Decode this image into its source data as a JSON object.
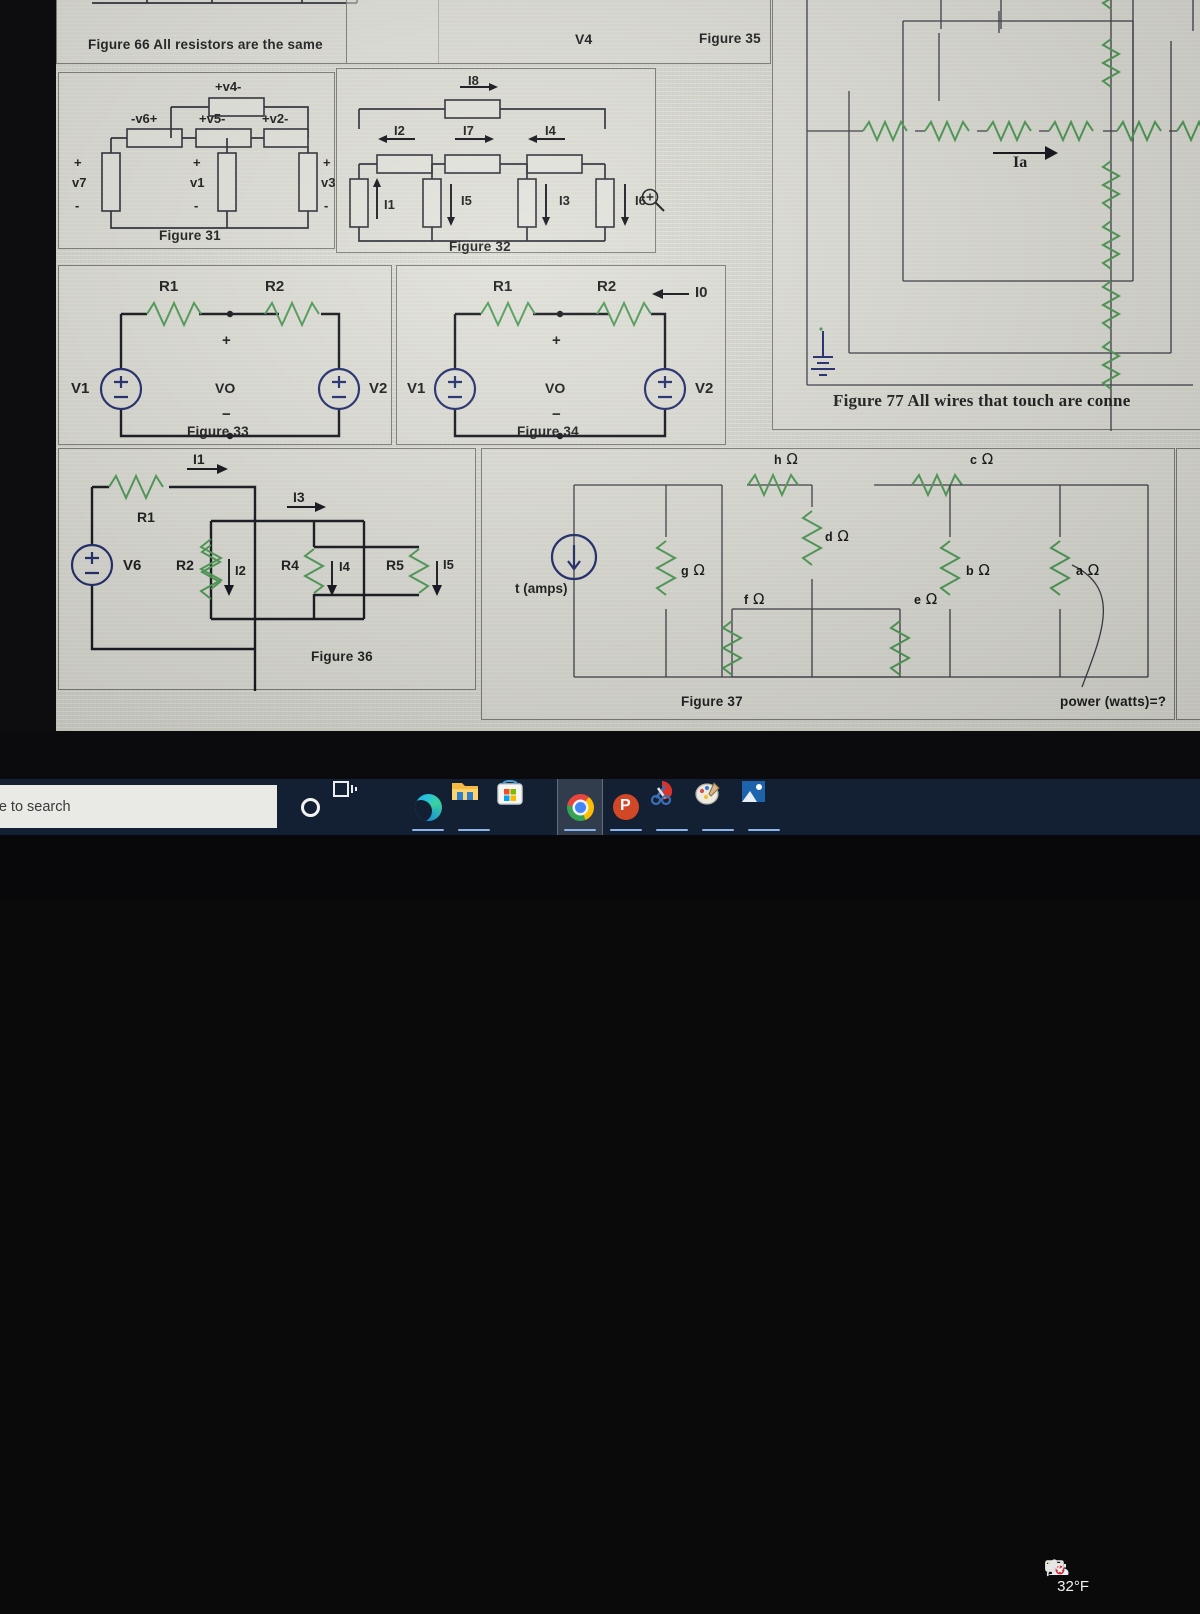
{
  "desktop": {
    "taskbar": {
      "search_placeholder": "re to search",
      "items": [
        {
          "name": "cortana-icon",
          "label": "Cortana"
        },
        {
          "name": "task-view-icon",
          "label": "Task View"
        },
        {
          "name": "edge-icon",
          "label": "Microsoft Edge"
        },
        {
          "name": "file-explorer-icon",
          "label": "File Explorer"
        },
        {
          "name": "microsoft-store-icon",
          "label": "Microsoft Store"
        },
        {
          "name": "chrome-icon",
          "label": "Google Chrome"
        },
        {
          "name": "powerpoint-icon",
          "label": "Microsoft PowerPoint"
        },
        {
          "name": "snipping-tool-icon",
          "label": "Snip & Sketch"
        },
        {
          "name": "paint-icon",
          "label": "Paint"
        },
        {
          "name": "photos-icon",
          "label": "Photos"
        }
      ],
      "tray": {
        "weather_temp": "32°F",
        "weather_icon": "partly-sunny-icon",
        "show_hidden_icons": "chevron-up-icon",
        "icons": [
          "meet-now-icon",
          "battery-charging-icon",
          "network-disconnected-icon",
          "volume-icon",
          "pen-icon"
        ]
      }
    },
    "accent_color": "#132033",
    "paper_color": "#d9d8d2",
    "resistor_color": "#4e9b55",
    "wire_color": "#2b2b36",
    "source_color": "#1f2a6b"
  },
  "figures": [
    {
      "id": "fig66",
      "caption": "Figure 66 All resistors are the same",
      "note": "top strip, partially cut off above"
    },
    {
      "id": "fig31",
      "caption": "Figure 31",
      "labels": [
        "+v4-",
        "-v6+",
        "+v5-",
        "+v2-",
        "v7",
        "v1",
        "v3",
        "+",
        "-",
        "+",
        "-",
        "+",
        "-"
      ],
      "elements": {
        "top_branch": "+v4-",
        "series": [
          "-v6+",
          "+v5-",
          "+v2-"
        ],
        "verticals": [
          "v7",
          "v1",
          "v3"
        ]
      }
    },
    {
      "id": "fig32",
      "caption": "Figure 32",
      "currents_top": [
        "I8"
      ],
      "currents_middle": [
        "I2",
        "I7",
        "I4"
      ],
      "currents_vertical": [
        "I1",
        "I5",
        "I3",
        "I6"
      ],
      "arrow_dirs": {
        "I8": "right",
        "I2": "left",
        "I7": "right",
        "I4": "left",
        "I1": "up",
        "I5": "down",
        "I3": "down",
        "I6": "down"
      },
      "zoom_cursor": "magnifier-icon"
    },
    {
      "id": "fig33",
      "caption": "Figure 33",
      "labels": [
        "R1",
        "R2",
        "V1",
        "V2",
        "VO",
        "+",
        "−"
      ]
    },
    {
      "id": "fig34",
      "caption": "Figure 34",
      "labels": [
        "R1",
        "R2",
        "V1",
        "V2",
        "VO",
        "+",
        "−"
      ],
      "current": "I0",
      "current_dir": "left"
    },
    {
      "id": "fig35",
      "caption": "Figure 35",
      "labels": [
        "V4",
        "-",
        "+"
      ],
      "has_ground": true
    },
    {
      "id": "fig36",
      "caption": "Figure 36",
      "labels": [
        "R1",
        "R2",
        "R4",
        "R5",
        "V6"
      ],
      "currents": [
        "I1",
        "I3",
        "I2",
        "I4",
        "I5"
      ],
      "arrow_dirs": {
        "I1": "right",
        "I3": "right",
        "I2": "down",
        "I4": "down",
        "I5": "down"
      }
    },
    {
      "id": "fig37",
      "caption": "Figure 37",
      "source_label": "t (amps)",
      "source_dir": "down",
      "question": "power (watts)=?",
      "resistors": [
        {
          "label": "h",
          "unit": "Ω",
          "orientation": "horizontal"
        },
        {
          "label": "c",
          "unit": "Ω",
          "orientation": "horizontal"
        },
        {
          "label": "d",
          "unit": "Ω",
          "orientation": "vertical"
        },
        {
          "label": "g",
          "unit": "Ω",
          "orientation": "vertical"
        },
        {
          "label": "f",
          "unit": "Ω",
          "orientation": "vertical"
        },
        {
          "label": "e",
          "unit": "Ω",
          "orientation": "vertical"
        },
        {
          "label": "b",
          "unit": "Ω",
          "orientation": "vertical"
        },
        {
          "label": "a",
          "unit": "Ω",
          "orientation": "vertical"
        }
      ]
    },
    {
      "id": "fig77",
      "caption": "Figure 77  All wires that touch are conne",
      "caption_truncated": true,
      "current": "Ia",
      "current_dir": "right",
      "has_battery": true
    }
  ]
}
